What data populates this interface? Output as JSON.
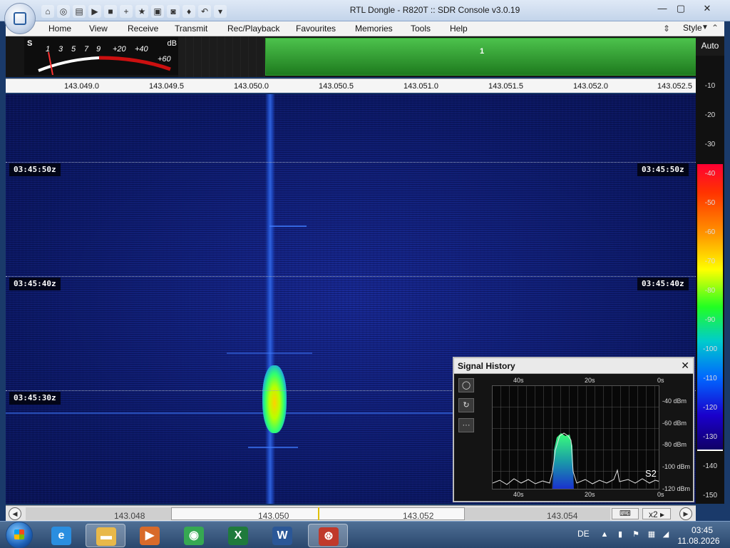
{
  "window": {
    "title": "RTL Dongle - R820T :: SDR Console v3.0.19",
    "controls": [
      "—",
      "▢",
      "✕"
    ]
  },
  "quick_access": [
    {
      "name": "home-icon",
      "glyph": "⌂"
    },
    {
      "name": "lifebuoy-icon",
      "glyph": "◎"
    },
    {
      "name": "folder-icon",
      "glyph": "▤"
    },
    {
      "name": "play-icon",
      "glyph": "▶"
    },
    {
      "name": "stop-icon",
      "glyph": "■"
    },
    {
      "name": "plus-icon",
      "glyph": "+"
    },
    {
      "name": "star-icon",
      "glyph": "★"
    },
    {
      "name": "lock-icon",
      "glyph": "▣"
    },
    {
      "name": "camera-icon",
      "glyph": "◙"
    },
    {
      "name": "drop-icon",
      "glyph": "♦"
    },
    {
      "name": "undo-icon",
      "glyph": "↶"
    },
    {
      "name": "dropdown-icon",
      "glyph": "▾"
    }
  ],
  "menu": {
    "items": [
      "Home",
      "View",
      "Receive",
      "Transmit",
      "Rec/Playback",
      "Favourites",
      "Memories",
      "Tools",
      "Help"
    ],
    "style_label": "Style"
  },
  "smeter": {
    "s_label": "S",
    "db_label": "dB",
    "scale_white": [
      "1",
      "3",
      "5",
      "7",
      "9"
    ],
    "scale_red": [
      "+20",
      "+40",
      "+60"
    ]
  },
  "spectrum": {
    "marker": "1",
    "auto_label": "Auto"
  },
  "ruler": {
    "ticks": [
      "143.049.0",
      "143.049.5",
      "143.050.0",
      "143.050.5",
      "143.051.0",
      "143.051.5",
      "143.052.0",
      "143.052.5"
    ]
  },
  "waterfall": {
    "timestamps": [
      "03:45:50z",
      "03:45:40z",
      "03:45:30z"
    ]
  },
  "color_scale": {
    "labels": [
      "-10",
      "-20",
      "-30",
      "-40",
      "-50",
      "-60",
      "-70",
      "-80",
      "-90",
      "-100",
      "-110",
      "-120",
      "-130",
      "-140",
      "-150"
    ]
  },
  "navbar": {
    "freqs": [
      "143.048",
      "143.050",
      "143.052",
      "143.054"
    ],
    "zoom": "x2",
    "keyboard_icon": "keyboard-icon"
  },
  "signal_history": {
    "title": "Signal History",
    "close": "✕",
    "tools": [
      "◯",
      "↻",
      "···"
    ],
    "x_top": [
      "40s",
      "20s",
      "0s"
    ],
    "x_bottom": [
      "40s",
      "20s",
      "0s"
    ],
    "y_labels": [
      "-40 dBm",
      "-60 dBm",
      "-80 dBm",
      "-100 dBm",
      "-120 dBm"
    ],
    "s_reading": "S2"
  },
  "taskbar": {
    "apps": [
      {
        "name": "internet-explorer-icon",
        "glyph": "e",
        "color": "#2a8ee0"
      },
      {
        "name": "file-explorer-icon",
        "glyph": "▬",
        "color": "#e8b84a"
      },
      {
        "name": "media-player-icon",
        "glyph": "▶",
        "color": "#d86a2a"
      },
      {
        "name": "chrome-icon",
        "glyph": "◉",
        "color": "#36a852"
      },
      {
        "name": "excel-icon",
        "glyph": "X",
        "color": "#1f7a3c"
      },
      {
        "name": "word-icon",
        "glyph": "W",
        "color": "#2b5797"
      },
      {
        "name": "sdr-console-icon",
        "glyph": "⊛",
        "color": "#c0392b"
      }
    ],
    "lang": "DE",
    "time": "03:45",
    "date": "11.08.2026"
  }
}
